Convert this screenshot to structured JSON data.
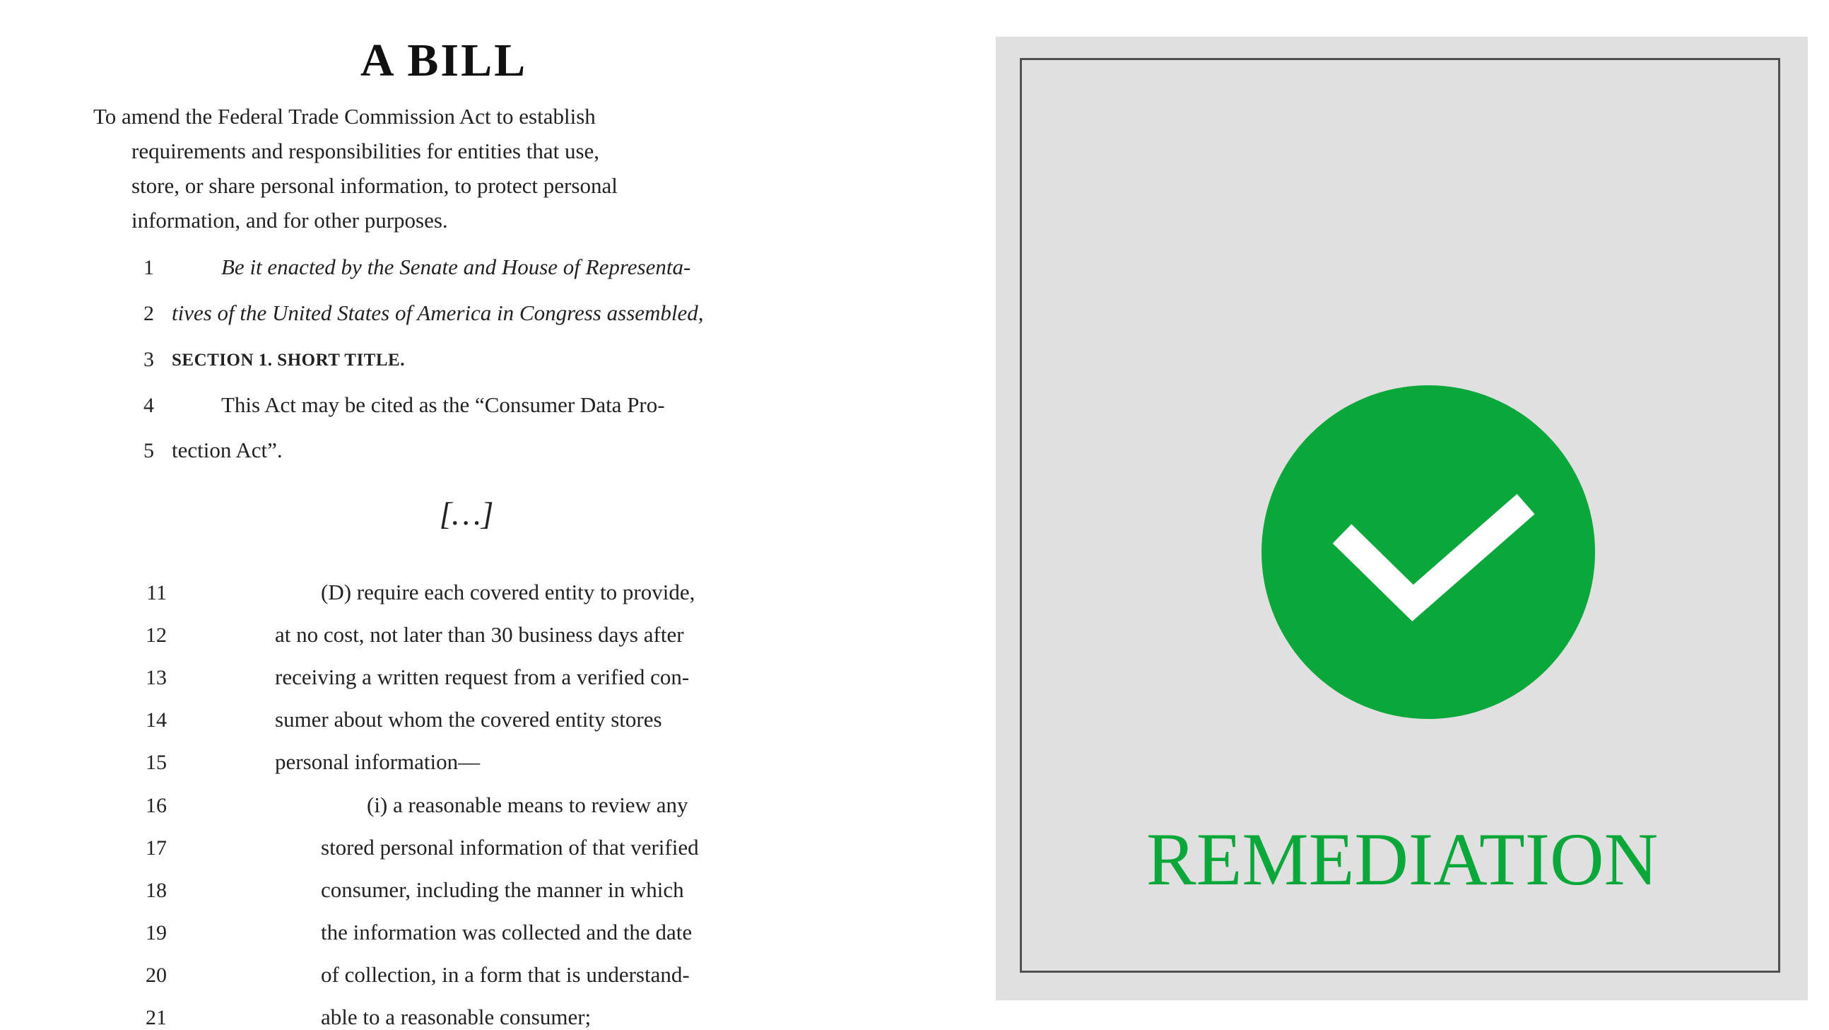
{
  "document": {
    "title": "A BILL",
    "purpose": {
      "first_line": "To amend the Federal Trade Commission Act to establish",
      "lines": [
        "requirements and responsibilities for entities that use,",
        "store, or share personal information, to protect personal",
        "information, and for other purposes."
      ]
    },
    "lines_top": [
      {
        "num": "1",
        "text": "Be it enacted by the Senate and House of Representa-"
      },
      {
        "num": "2",
        "text": "tives of the United States of America in Congress assembled,"
      },
      {
        "num": "3",
        "text": "SECTION 1. SHORT TITLE."
      },
      {
        "num": "4",
        "text": "This Act may be cited as the “Consumer Data Pro-"
      },
      {
        "num": "5",
        "text": "tection Act”."
      }
    ],
    "ellipsis": "[…]",
    "lines_bottom": [
      {
        "num": "11",
        "text": "(D) require each covered entity to provide,"
      },
      {
        "num": "12",
        "text": "at no cost, not later than 30 business days after"
      },
      {
        "num": "13",
        "text": "receiving a written request from a verified con-"
      },
      {
        "num": "14",
        "text": "sumer about whom the covered entity stores"
      },
      {
        "num": "15",
        "text": "personal information—"
      },
      {
        "num": "16",
        "text": "(i) a reasonable means to review any"
      },
      {
        "num": "17",
        "text": "stored personal information of that verified"
      },
      {
        "num": "18",
        "text": "consumer, including the manner in which"
      },
      {
        "num": "19",
        "text": "the information was collected and the date"
      },
      {
        "num": "20",
        "text": "of collection, in a form that is understand-"
      },
      {
        "num": "21",
        "text": "able to a reasonable consumer;"
      }
    ]
  },
  "panel": {
    "label": "REMEDIATION",
    "icon": "check-circle-icon",
    "colors": {
      "accent": "#0aa73b",
      "panel_background": "#e0e0e0",
      "frame_border": "#505050"
    }
  }
}
